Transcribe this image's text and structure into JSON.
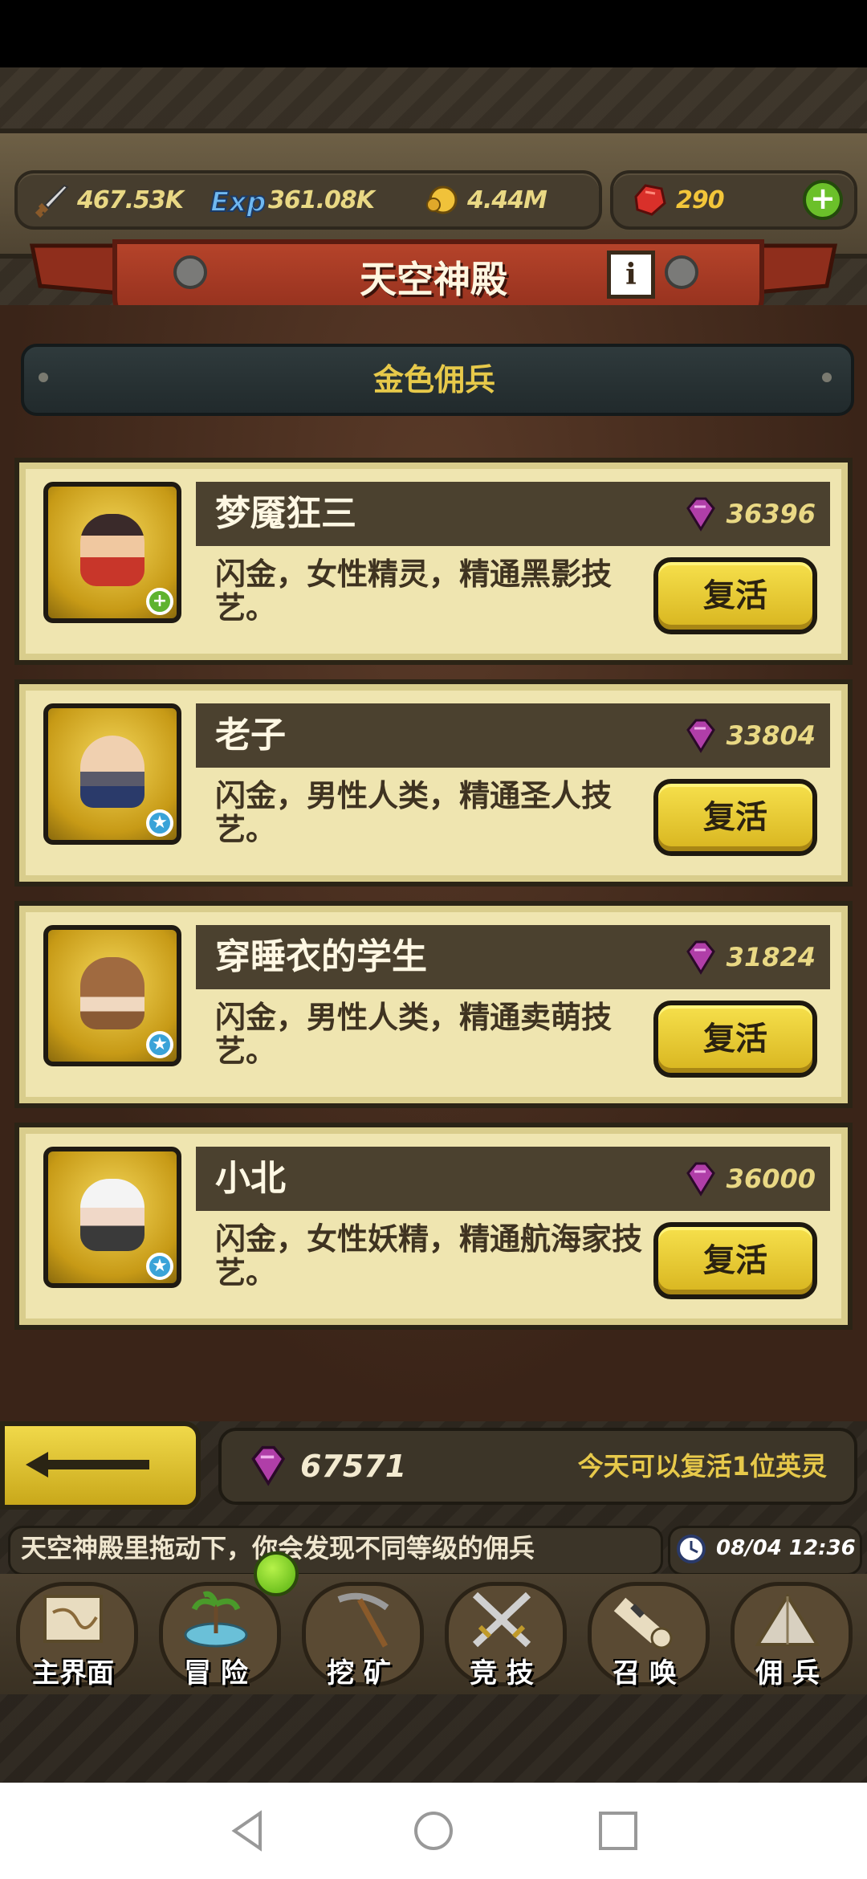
{
  "resources": {
    "attack": "467.53K",
    "exp": "361.08K",
    "gold": "4.44M",
    "rubies": "290"
  },
  "temple": {
    "title": "天空神殿",
    "subtitle": "金色佣兵"
  },
  "heroes": [
    {
      "name": "梦魇狂三",
      "cost": "36396",
      "desc": "闪金，女性精灵，精通黑影技艺。",
      "button": "复活",
      "badge": "plus"
    },
    {
      "name": "老子",
      "cost": "33804",
      "desc": "闪金，男性人类，精通圣人技艺。",
      "button": "复活",
      "badge": "star"
    },
    {
      "name": "穿睡衣的学生",
      "cost": "31824",
      "desc": "闪金，男性人类，精通卖萌技艺。",
      "button": "复活",
      "badge": "star"
    },
    {
      "name": "小北",
      "cost": "36000",
      "desc": "闪金，女性妖精，精通航海家技艺。",
      "button": "复活",
      "badge": "star"
    }
  ],
  "footer": {
    "gem_total": "67571",
    "revive_note": "今天可以复活1位英灵"
  },
  "ticker": {
    "text": "天空神殿里拖动下，你会发现不同等级的佣兵",
    "clock": "08/04 12:36"
  },
  "nav": {
    "items": [
      "主界面",
      "冒 险",
      "挖 矿",
      "竞 技",
      "召 唤",
      "佣 兵"
    ]
  },
  "colors": {
    "gold_text": "#e7c94a",
    "card_bg": "#efe5b0",
    "button_yellow": "#f6e04c",
    "gem_purple": "#b03ea8"
  }
}
